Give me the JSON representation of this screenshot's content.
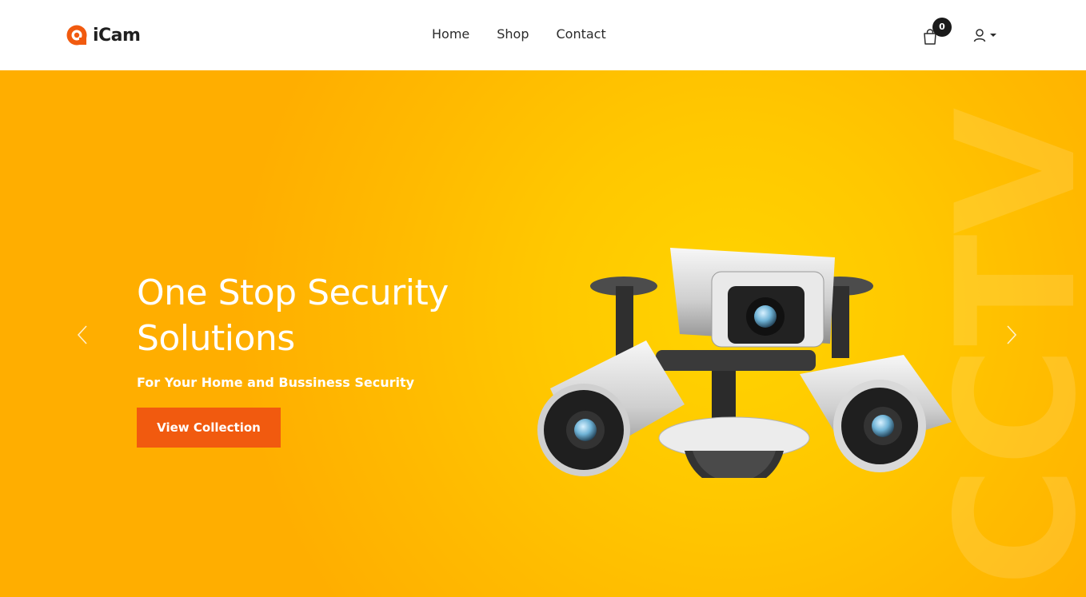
{
  "brand": {
    "name": "iCam",
    "color": "#f15a0f"
  },
  "nav": {
    "items": [
      "Home",
      "Shop",
      "Contact"
    ]
  },
  "cart": {
    "count": "0"
  },
  "hero": {
    "title": "One Stop Security Solutions",
    "subtitle": "For Your Home and Bussiness Security",
    "button_label": "View Collection",
    "watermark": "CCTV",
    "background_color": "#ffb800",
    "button_color": "#f15a0f"
  },
  "icons": [
    "logo-icon",
    "cart-icon",
    "user-icon",
    "chevron-left-icon",
    "chevron-right-icon"
  ]
}
